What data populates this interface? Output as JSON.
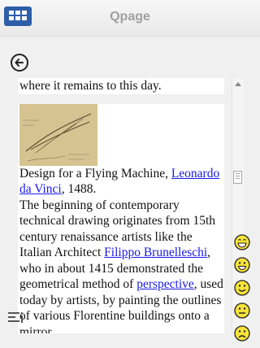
{
  "header": {
    "title": "Qpage"
  },
  "icons": {
    "menu": "grid-menu-icon",
    "back": "back-arrow-icon",
    "drag": "drag-handle-icon"
  },
  "article": {
    "line_top": "where it remains to this day.",
    "caption_prefix": "Design for a Flying Machine, ",
    "caption_link": "Leonardo da Vinci",
    "caption_suffix": ", 1488.",
    "p1": "The beginning of contemporary technical drawing originates from 15th century renaissance artists like the Italian Architect ",
    "link_brunelleschi": "Filippo Brunelleschi",
    "p2": ", who in about 1415 demonstrated the geometrical method of ",
    "link_perspective": "perspective",
    "p3": ", used today by artists, by painting the outlines of various Florentine buildings onto a mirror"
  },
  "emojis": [
    "laughing",
    "grinning",
    "smiling",
    "neutral",
    "sad"
  ],
  "colors": {
    "accent": "#2f5ea8",
    "link": "#1a1ae6",
    "emoji": "#f5e23a"
  }
}
